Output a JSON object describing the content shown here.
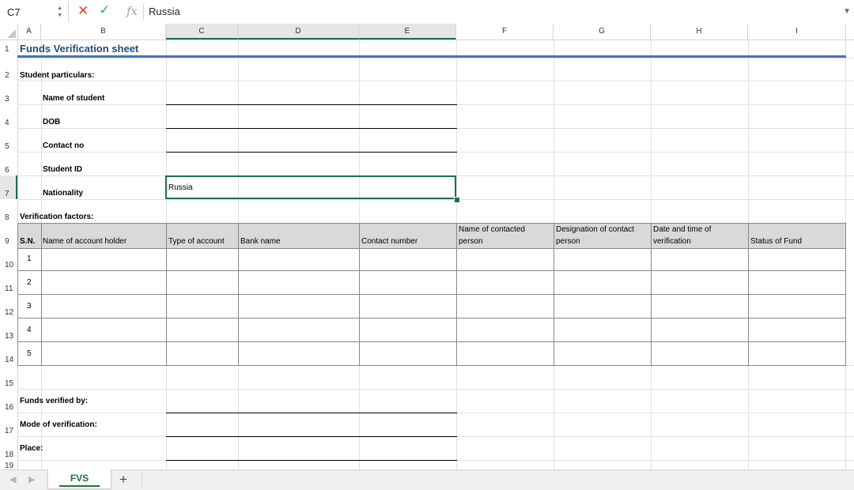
{
  "formula_bar": {
    "cell_ref": "C7",
    "formula_value": "Russia",
    "cancel_glyph": "✕",
    "accept_glyph": "✓",
    "fx_glyph": "fx"
  },
  "columns": [
    "A",
    "B",
    "C",
    "D",
    "E",
    "F",
    "G",
    "H",
    "I"
  ],
  "rows": [
    "1",
    "2",
    "3",
    "4",
    "5",
    "6",
    "7",
    "8",
    "9",
    "10",
    "11",
    "12",
    "13",
    "14",
    "15",
    "16",
    "17",
    "18",
    "19"
  ],
  "sheet": {
    "title": "Funds Verification sheet",
    "student_particulars_label": "Student particulars:",
    "fields": {
      "name_label": "Name of student",
      "dob_label": "DOB",
      "contact_label": "Contact no",
      "student_id_label": "Student ID",
      "nationality_label": "Nationality",
      "nationality_value": "Russia"
    },
    "verification_factors_label": "Verification factors:",
    "table": {
      "headers": {
        "sn": "S.N.",
        "holder": "Name of account holder",
        "type": "Type of account",
        "bank": "Bank name",
        "contact_number": "Contact number",
        "contacted_person_1": "Name of contacted",
        "contacted_person_2": "person",
        "designation_1": "Designation of contact",
        "designation_2": "person",
        "datetime_1": "Date and time of",
        "datetime_2": "verification",
        "status": "Status of Fund"
      },
      "serials": [
        "1",
        "2",
        "3",
        "4",
        "5"
      ]
    },
    "footer": {
      "verified_by": "Funds verified by:",
      "mode": "Mode of verification:",
      "place": "Place:"
    }
  },
  "tabs": {
    "active_tab": "FVS",
    "add_glyph": "+",
    "prev_glyph": "◀",
    "next_glyph": "▶"
  },
  "colors": {
    "accent_green": "#1e7145",
    "title_blue": "#1f4e79",
    "rule_blue": "#4472c4",
    "header_fill": "#d9d9d9"
  }
}
